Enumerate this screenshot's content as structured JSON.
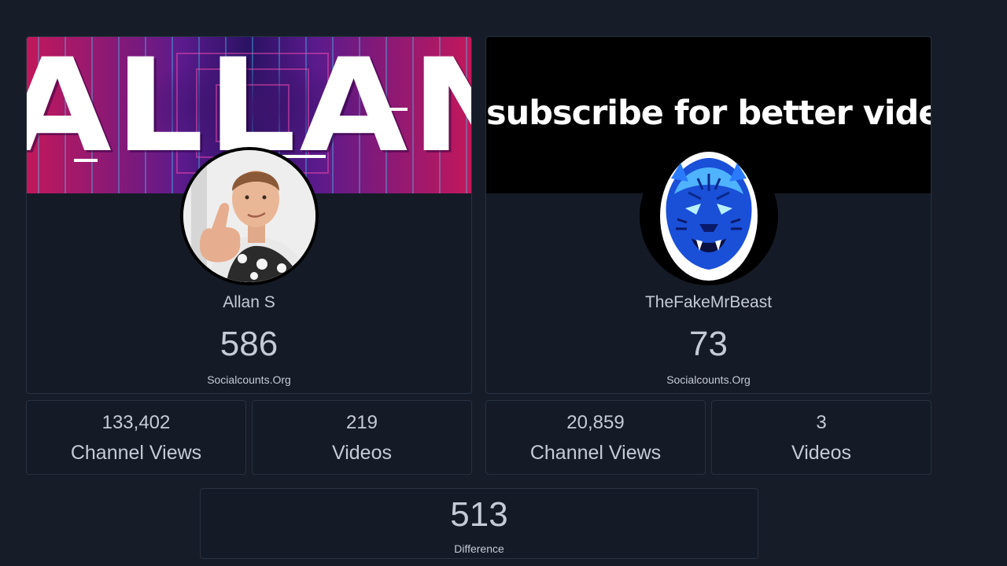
{
  "channels": [
    {
      "banner_text": "ALLAN S",
      "name": "Allan S",
      "subscribers": "586",
      "source": "Socialcounts.Org",
      "stats": [
        {
          "value": "133,402",
          "label": "Channel Views"
        },
        {
          "value": "219",
          "label": "Videos"
        }
      ]
    },
    {
      "banner_text": "subscribe for better videos",
      "name": "TheFakeMrBeast",
      "subscribers": "73",
      "source": "Socialcounts.Org",
      "stats": [
        {
          "value": "20,859",
          "label": "Channel Views"
        },
        {
          "value": "3",
          "label": "Videos"
        }
      ]
    }
  ],
  "difference": {
    "value": "513",
    "label": "Difference"
  },
  "colors": {
    "background": "#161d28",
    "card": "#141b26",
    "card_border": "#283141",
    "text": "#c5cbd6"
  },
  "icons": {
    "left_avatar": "boy-thumbs-up-avatar",
    "right_avatar": "blue-tiger-avatar"
  }
}
